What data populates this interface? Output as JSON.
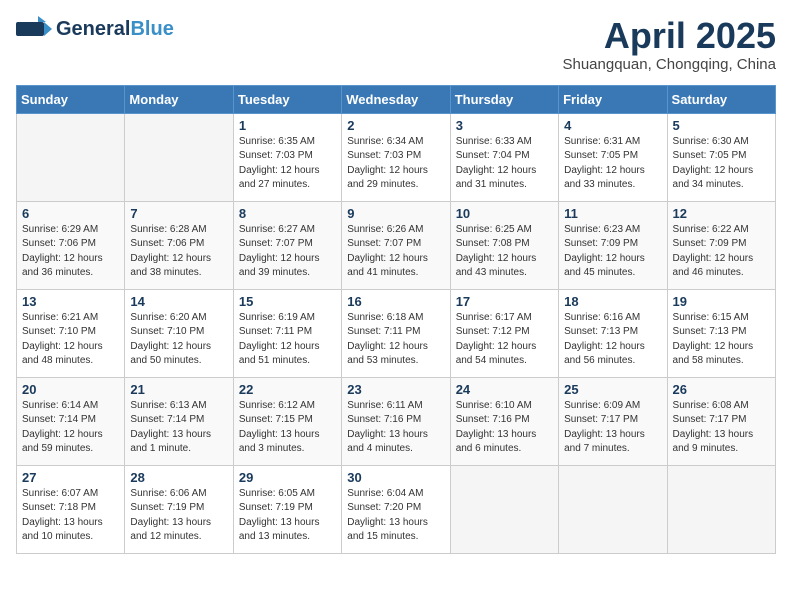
{
  "header": {
    "logo_line1a": "General",
    "logo_line1b": "Blue",
    "month": "April 2025",
    "location": "Shuangquan, Chongqing, China"
  },
  "weekdays": [
    "Sunday",
    "Monday",
    "Tuesday",
    "Wednesday",
    "Thursday",
    "Friday",
    "Saturday"
  ],
  "weeks": [
    [
      {
        "day": "",
        "detail": ""
      },
      {
        "day": "",
        "detail": ""
      },
      {
        "day": "1",
        "detail": "Sunrise: 6:35 AM\nSunset: 7:03 PM\nDaylight: 12 hours\nand 27 minutes."
      },
      {
        "day": "2",
        "detail": "Sunrise: 6:34 AM\nSunset: 7:03 PM\nDaylight: 12 hours\nand 29 minutes."
      },
      {
        "day": "3",
        "detail": "Sunrise: 6:33 AM\nSunset: 7:04 PM\nDaylight: 12 hours\nand 31 minutes."
      },
      {
        "day": "4",
        "detail": "Sunrise: 6:31 AM\nSunset: 7:05 PM\nDaylight: 12 hours\nand 33 minutes."
      },
      {
        "day": "5",
        "detail": "Sunrise: 6:30 AM\nSunset: 7:05 PM\nDaylight: 12 hours\nand 34 minutes."
      }
    ],
    [
      {
        "day": "6",
        "detail": "Sunrise: 6:29 AM\nSunset: 7:06 PM\nDaylight: 12 hours\nand 36 minutes."
      },
      {
        "day": "7",
        "detail": "Sunrise: 6:28 AM\nSunset: 7:06 PM\nDaylight: 12 hours\nand 38 minutes."
      },
      {
        "day": "8",
        "detail": "Sunrise: 6:27 AM\nSunset: 7:07 PM\nDaylight: 12 hours\nand 39 minutes."
      },
      {
        "day": "9",
        "detail": "Sunrise: 6:26 AM\nSunset: 7:07 PM\nDaylight: 12 hours\nand 41 minutes."
      },
      {
        "day": "10",
        "detail": "Sunrise: 6:25 AM\nSunset: 7:08 PM\nDaylight: 12 hours\nand 43 minutes."
      },
      {
        "day": "11",
        "detail": "Sunrise: 6:23 AM\nSunset: 7:09 PM\nDaylight: 12 hours\nand 45 minutes."
      },
      {
        "day": "12",
        "detail": "Sunrise: 6:22 AM\nSunset: 7:09 PM\nDaylight: 12 hours\nand 46 minutes."
      }
    ],
    [
      {
        "day": "13",
        "detail": "Sunrise: 6:21 AM\nSunset: 7:10 PM\nDaylight: 12 hours\nand 48 minutes."
      },
      {
        "day": "14",
        "detail": "Sunrise: 6:20 AM\nSunset: 7:10 PM\nDaylight: 12 hours\nand 50 minutes."
      },
      {
        "day": "15",
        "detail": "Sunrise: 6:19 AM\nSunset: 7:11 PM\nDaylight: 12 hours\nand 51 minutes."
      },
      {
        "day": "16",
        "detail": "Sunrise: 6:18 AM\nSunset: 7:11 PM\nDaylight: 12 hours\nand 53 minutes."
      },
      {
        "day": "17",
        "detail": "Sunrise: 6:17 AM\nSunset: 7:12 PM\nDaylight: 12 hours\nand 54 minutes."
      },
      {
        "day": "18",
        "detail": "Sunrise: 6:16 AM\nSunset: 7:13 PM\nDaylight: 12 hours\nand 56 minutes."
      },
      {
        "day": "19",
        "detail": "Sunrise: 6:15 AM\nSunset: 7:13 PM\nDaylight: 12 hours\nand 58 minutes."
      }
    ],
    [
      {
        "day": "20",
        "detail": "Sunrise: 6:14 AM\nSunset: 7:14 PM\nDaylight: 12 hours\nand 59 minutes."
      },
      {
        "day": "21",
        "detail": "Sunrise: 6:13 AM\nSunset: 7:14 PM\nDaylight: 13 hours\nand 1 minute."
      },
      {
        "day": "22",
        "detail": "Sunrise: 6:12 AM\nSunset: 7:15 PM\nDaylight: 13 hours\nand 3 minutes."
      },
      {
        "day": "23",
        "detail": "Sunrise: 6:11 AM\nSunset: 7:16 PM\nDaylight: 13 hours\nand 4 minutes."
      },
      {
        "day": "24",
        "detail": "Sunrise: 6:10 AM\nSunset: 7:16 PM\nDaylight: 13 hours\nand 6 minutes."
      },
      {
        "day": "25",
        "detail": "Sunrise: 6:09 AM\nSunset: 7:17 PM\nDaylight: 13 hours\nand 7 minutes."
      },
      {
        "day": "26",
        "detail": "Sunrise: 6:08 AM\nSunset: 7:17 PM\nDaylight: 13 hours\nand 9 minutes."
      }
    ],
    [
      {
        "day": "27",
        "detail": "Sunrise: 6:07 AM\nSunset: 7:18 PM\nDaylight: 13 hours\nand 10 minutes."
      },
      {
        "day": "28",
        "detail": "Sunrise: 6:06 AM\nSunset: 7:19 PM\nDaylight: 13 hours\nand 12 minutes."
      },
      {
        "day": "29",
        "detail": "Sunrise: 6:05 AM\nSunset: 7:19 PM\nDaylight: 13 hours\nand 13 minutes."
      },
      {
        "day": "30",
        "detail": "Sunrise: 6:04 AM\nSunset: 7:20 PM\nDaylight: 13 hours\nand 15 minutes."
      },
      {
        "day": "",
        "detail": ""
      },
      {
        "day": "",
        "detail": ""
      },
      {
        "day": "",
        "detail": ""
      }
    ]
  ]
}
